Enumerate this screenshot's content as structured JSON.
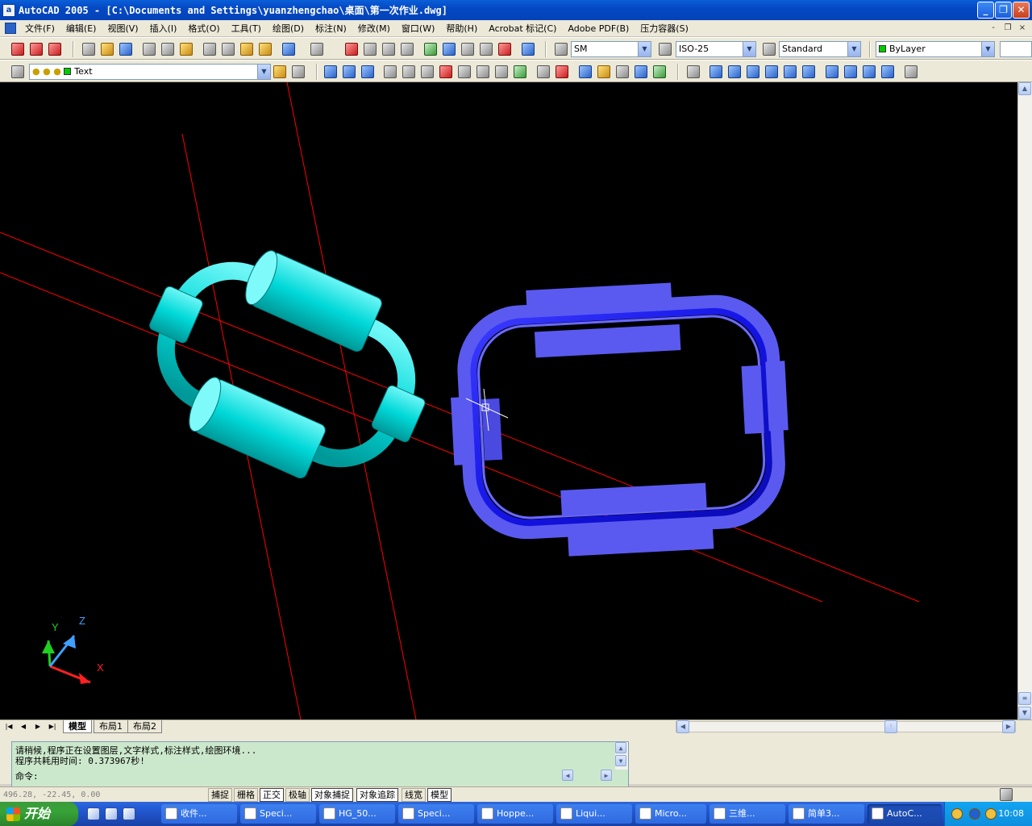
{
  "window": {
    "title": "AutoCAD 2005 - [C:\\Documents and Settings\\yuanzhengchao\\桌面\\第一次作业.dwg]",
    "app_icon": "autocad-icon",
    "controls": {
      "minimize": "_",
      "restore": "❐",
      "close": "✕"
    }
  },
  "menu": {
    "items": [
      "文件(F)",
      "编辑(E)",
      "视图(V)",
      "插入(I)",
      "格式(O)",
      "工具(T)",
      "绘图(D)",
      "标注(N)",
      "修改(M)",
      "窗口(W)",
      "帮助(H)",
      "Acrobat 标记(C)",
      "Adobe PDF(B)",
      "压力容器(S)"
    ],
    "doc_controls": [
      "-",
      "❐",
      "×"
    ]
  },
  "toolbar1": {
    "text_style": "SM",
    "dim_style": "ISO-25",
    "table_style": "Standard",
    "color": "ByLayer"
  },
  "toolbar2": {
    "layer": "Text"
  },
  "viewport": {
    "background": "#000000",
    "ucs": {
      "x": "X",
      "y": "Y",
      "z": "Z"
    },
    "colors": {
      "left_link": "#00d8d8",
      "right_link": "#5a5af0",
      "axis_lines": "#ff0000"
    }
  },
  "layout_tabs": [
    "模型",
    "布局1",
    "布局2"
  ],
  "command": {
    "lines": [
      "请稍候,程序正在设置图层,文字样式,标注样式,绘图环境...",
      "程序共耗用时间: 0.373967秒!"
    ],
    "prompt": "命令:"
  },
  "status": {
    "coords": "496.28, -22.45, 0.00",
    "toggles": [
      {
        "label": "捕捉",
        "on": false
      },
      {
        "label": "栅格",
        "on": false
      },
      {
        "label": "正交",
        "on": true
      },
      {
        "label": "极轴",
        "on": false
      },
      {
        "label": "对象捕捉",
        "on": true
      },
      {
        "label": "对象追踪",
        "on": true
      },
      {
        "label": "线宽",
        "on": false
      },
      {
        "label": "模型",
        "on": true
      }
    ]
  },
  "taskbar": {
    "start": "开始",
    "items": [
      "收件...",
      "Speci...",
      "HG_50...",
      "Speci...",
      "Hoppe...",
      "Liqui...",
      "Micro...",
      "三维...",
      "简单3...",
      "AutoC..."
    ],
    "clock": "10:08"
  }
}
